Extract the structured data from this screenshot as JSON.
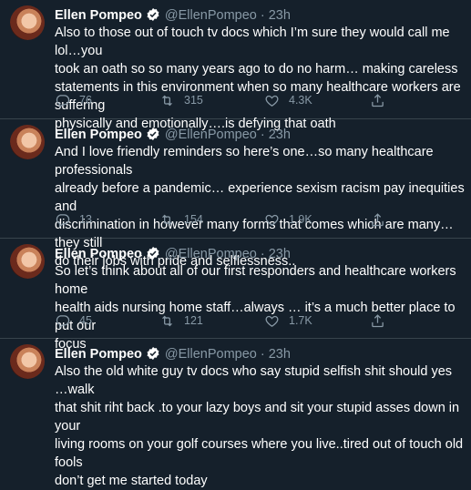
{
  "tweets": [
    {
      "name": "Ellen Pompeo",
      "handle": "@EllenPompeo",
      "time": "23h",
      "text": "Also to those out of touch tv docs which I’m sure they would call me lol…you\ntook an oath so so many years ago to do no harm… making careless\nstatements in this environment when so many healthcare workers are suffering\nphysically and emotionally….is defying that oath",
      "replies": "76",
      "retweets": "315",
      "likes": "4.3K"
    },
    {
      "name": "Ellen Pompeo",
      "handle": "@EllenPompeo",
      "time": "23h",
      "text": "And I love friendly reminders so here’s one…so many healthcare professionals\nalready before a pandemic… experience sexism racism pay inequities and\ndiscrimination in however many forms that comes which are many…they still\ndo their jobs with pride and selflessness..",
      "replies": "13",
      "retweets": "154",
      "likes": "1.9K"
    },
    {
      "name": "Ellen Pompeo",
      "handle": "@EllenPompeo",
      "time": "23h",
      "text": "So let’s think about all of our first responders and healthcare workers home\nhealth aids nursing home staff…always … it’s a much better place to put our\nfocus",
      "replies": "45",
      "retweets": "121",
      "likes": "1.7K"
    },
    {
      "name": "Ellen Pompeo",
      "handle": "@EllenPompeo",
      "time": "23h",
      "text": "Also the old white guy tv docs who say stupid selfish shit should yes …walk\nthat shit riht back .to your lazy boys and sit your stupid asses down in your\nliving rooms on your golf courses where you live..tired out of touch old fools\ndon’t get me started today"
    }
  ]
}
